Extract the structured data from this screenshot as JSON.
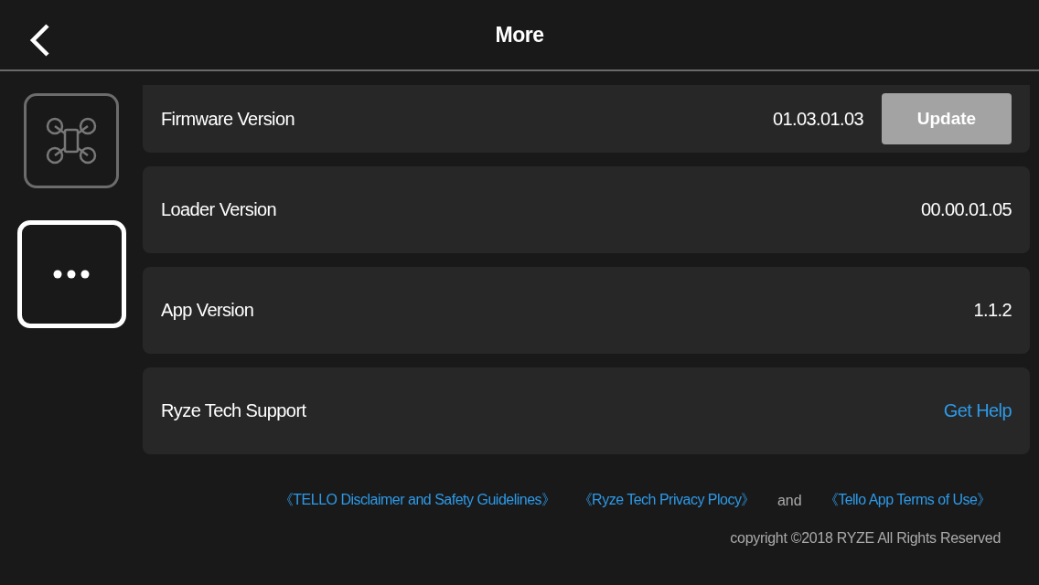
{
  "header": {
    "title": "More"
  },
  "sidebar": {
    "tabs": [
      {
        "kind": "drone",
        "selected": false
      },
      {
        "kind": "more",
        "selected": true
      }
    ]
  },
  "rows": [
    {
      "kind": "button",
      "label": "Firmware Version",
      "value": "01.03.01.03",
      "button": "Update",
      "disabled": true
    },
    {
      "kind": "value",
      "label": "Loader Version",
      "value": "00.00.01.05"
    },
    {
      "kind": "value",
      "label": "App Version",
      "value": "1.1.2"
    },
    {
      "kind": "link",
      "label": "Ryze Tech Support",
      "value": "Get Help"
    }
  ],
  "footer": {
    "items": [
      {
        "kind": "link",
        "text": "《TELLO Disclaimer and Safety Guidelines》"
      },
      {
        "kind": "link",
        "text": "《Ryze Tech Privacy Plocy》"
      },
      {
        "kind": "text",
        "text": "and"
      },
      {
        "kind": "link",
        "text": "《Tello App Terms of Use》"
      }
    ],
    "copyright": "copyright ©2018 RYZE All Rights Reserved"
  }
}
